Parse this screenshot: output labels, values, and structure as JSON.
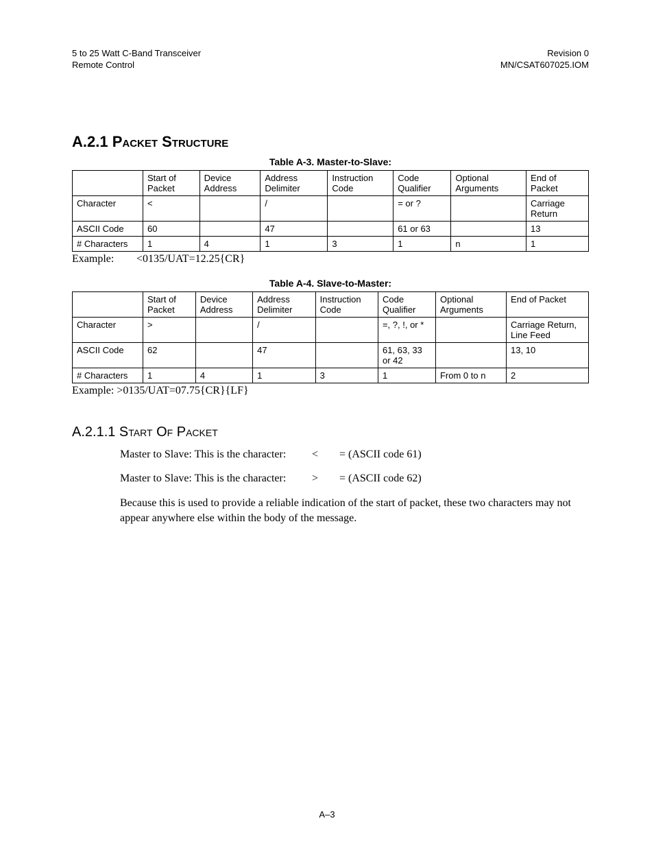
{
  "header": {
    "left1": "5 to 25 Watt C-Band Transceiver",
    "left2": "Remote Control",
    "right1": "Revision 0",
    "right2": "MN/CSAT607025.IOM"
  },
  "sections": {
    "a21": "A.2.1 Packet Structure",
    "a211": "A.2.1.1 Start Of Packet"
  },
  "table_a3": {
    "caption": "Table A-3.   Master-to-Slave:",
    "headers": [
      "",
      "Start of Packet",
      "Device Address",
      "Address Delimiter",
      "Instruction Code",
      "Code Qualifier",
      "Optional Arguments",
      "End of Packet"
    ],
    "rows": [
      {
        "label": "Character",
        "cells": [
          "<",
          "",
          "/",
          "",
          "= or ?",
          "",
          "Carriage Return"
        ]
      },
      {
        "label": "ASCII Code",
        "cells": [
          "60",
          "",
          "47",
          "",
          "61 or 63",
          "",
          "13"
        ]
      },
      {
        "label": "# Characters",
        "cells": [
          "1",
          "4",
          "1",
          "3",
          "1",
          "n",
          "1"
        ]
      }
    ],
    "example_lead": "Example:",
    "example_body": "<0135/UAT=12.25{CR}"
  },
  "table_a4": {
    "caption": "Table A-4.  Slave-to-Master:",
    "headers": [
      "",
      "Start of Packet",
      "Device Address",
      "Address Delimiter",
      "Instruction Code",
      "Code Qualifier",
      "Optional Arguments",
      "End of Packet"
    ],
    "rows": [
      {
        "label": "Character",
        "cells": [
          ">",
          "",
          "/",
          "",
          "=, ?, !, or *",
          "",
          "Carriage Return, Line Feed"
        ]
      },
      {
        "label": "ASCII Code",
        "cells": [
          "62",
          "",
          "47",
          "",
          "61, 63, 33 or 42",
          "",
          "13, 10"
        ]
      },
      {
        "label": "# Characters",
        "cells": [
          "1",
          "4",
          "1",
          "3",
          "1",
          "From 0 to n",
          "2"
        ]
      }
    ],
    "example": "Example: >0135/UAT=07.75{CR}{LF}"
  },
  "start_of_packet": {
    "line1_lead": "Master to Slave: This is the character:",
    "line1_sym": "<",
    "line1_tail": "= (ASCII code 61)",
    "line2_lead": "Master to Slave: This is the character:",
    "line2_sym": ">",
    "line2_tail": "= (ASCII code 62)",
    "para": "Because this is used to provide a reliable indication of the start of packet, these two characters may not appear anywhere else within the body of the message."
  },
  "page_number": "A–3"
}
